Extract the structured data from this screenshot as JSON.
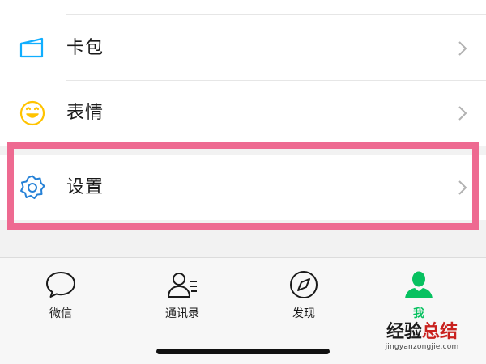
{
  "menu": {
    "items": [
      {
        "label": "卡包",
        "icon": "card-wallet-icon"
      },
      {
        "label": "表情",
        "icon": "smiley-icon"
      },
      {
        "label": "设置",
        "icon": "gear-icon"
      }
    ],
    "highlighted_item": "设置"
  },
  "tabbar": {
    "tabs": [
      {
        "label": "微信",
        "icon": "chat-bubble-icon",
        "active": false
      },
      {
        "label": "通讯录",
        "icon": "contacts-icon",
        "active": false
      },
      {
        "label": "发现",
        "icon": "compass-icon",
        "active": false
      },
      {
        "label": "我",
        "icon": "person-icon",
        "active": true
      }
    ]
  },
  "watermark": {
    "title_black": "经验",
    "title_red": "总结",
    "url": "jingyanzongjie.com"
  },
  "colors": {
    "accent_green": "#07c160",
    "highlight_pink": "#ee6a91",
    "gear_blue": "#2782d7",
    "card_teal": "#10aeff",
    "smiley_yellow": "#ffc300",
    "watermark_red": "#c9211e"
  }
}
